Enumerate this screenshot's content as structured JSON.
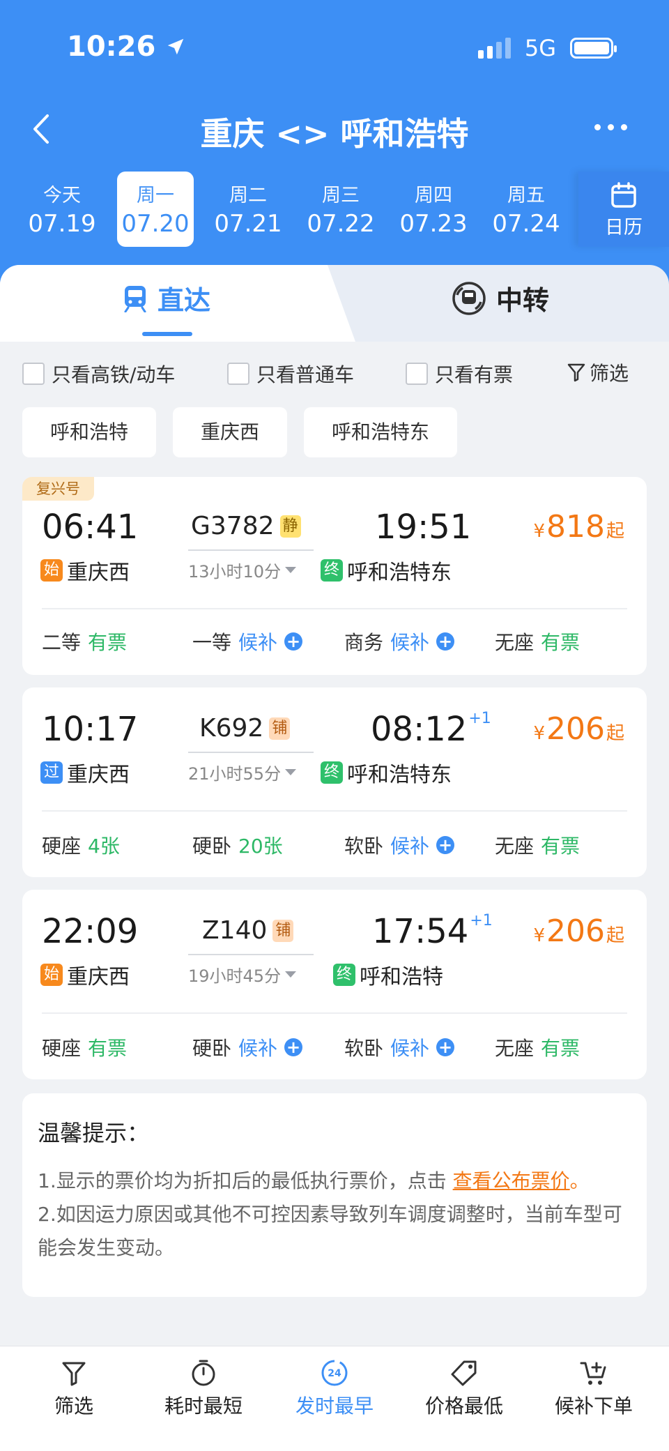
{
  "status": {
    "time": "10:26",
    "network": "5G"
  },
  "nav": {
    "title": "重庆 <> 呼和浩特"
  },
  "dates": [
    {
      "weekday": "今天",
      "date": "07.19"
    },
    {
      "weekday": "周一",
      "date": "07.20",
      "active": true
    },
    {
      "weekday": "周二",
      "date": "07.21"
    },
    {
      "weekday": "周三",
      "date": "07.22"
    },
    {
      "weekday": "周四",
      "date": "07.23"
    },
    {
      "weekday": "周五",
      "date": "07.24"
    }
  ],
  "calendar_label": "日历",
  "tabs": {
    "direct": "直达",
    "transfer": "中转"
  },
  "filters": {
    "high_speed": "只看高铁/动车",
    "normal": "只看普通车",
    "available": "只看有票",
    "filter": "筛选"
  },
  "stations": [
    "呼和浩特",
    "重庆西",
    "呼和浩特东"
  ],
  "trains": [
    {
      "badge": "复兴号",
      "dep_time": "06:41",
      "train_no": "G3782",
      "tag": "静",
      "duration": "13小时10分",
      "arr_time": "19:51",
      "arr_plus": "",
      "dep_tag": "始",
      "dep_station": "重庆西",
      "arr_tag": "终",
      "arr_station": "呼和浩特东",
      "price": "818",
      "yen": "¥",
      "qi": "起",
      "seats": [
        {
          "name": "二等",
          "value": "有票",
          "state": "ok"
        },
        {
          "name": "一等",
          "value": "候补",
          "state": "wait"
        },
        {
          "name": "商务",
          "value": "候补",
          "state": "wait"
        },
        {
          "name": "无座",
          "value": "有票",
          "state": "ok"
        }
      ]
    },
    {
      "badge": "",
      "dep_time": "10:17",
      "train_no": "K692",
      "tag": "铺",
      "duration": "21小时55分",
      "arr_time": "08:12",
      "arr_plus": "+1",
      "dep_tag": "过",
      "dep_station": "重庆西",
      "arr_tag": "终",
      "arr_station": "呼和浩特东",
      "price": "206",
      "yen": "¥",
      "qi": "起",
      "seats": [
        {
          "name": "硬座",
          "value": "4张",
          "state": "ok"
        },
        {
          "name": "硬卧",
          "value": "20张",
          "state": "ok"
        },
        {
          "name": "软卧",
          "value": "候补",
          "state": "wait"
        },
        {
          "name": "无座",
          "value": "有票",
          "state": "ok"
        }
      ]
    },
    {
      "badge": "",
      "dep_time": "22:09",
      "train_no": "Z140",
      "tag": "铺",
      "duration": "19小时45分",
      "arr_time": "17:54",
      "arr_plus": "+1",
      "dep_tag": "始",
      "dep_station": "重庆西",
      "arr_tag": "终",
      "arr_station": "呼和浩特",
      "price": "206",
      "yen": "¥",
      "qi": "起",
      "seats": [
        {
          "name": "硬座",
          "value": "有票",
          "state": "ok"
        },
        {
          "name": "硬卧",
          "value": "候补",
          "state": "wait"
        },
        {
          "name": "软卧",
          "value": "候补",
          "state": "wait"
        },
        {
          "name": "无座",
          "value": "有票",
          "state": "ok"
        }
      ]
    }
  ],
  "notice": {
    "title": "温馨提示：",
    "line1_prefix": "1.显示的票价均为折扣后的最低执行票价，点击 ",
    "line1_link": "查看公布票价",
    "line1_suffix": "。",
    "line2": "2.如因运力原因或其他不可控因素导致列车调度调整时，当前车型可能会发生变动。"
  },
  "bottom_bar": {
    "filter": "筛选",
    "shortest": "耗时最短",
    "earliest": "发时最早",
    "cheapest": "价格最低",
    "waitlist": "候补下单",
    "earliest_icon_text": "24"
  },
  "colors": {
    "brand": "#3d8ff5",
    "price": "#f37815",
    "available": "#2db866"
  }
}
